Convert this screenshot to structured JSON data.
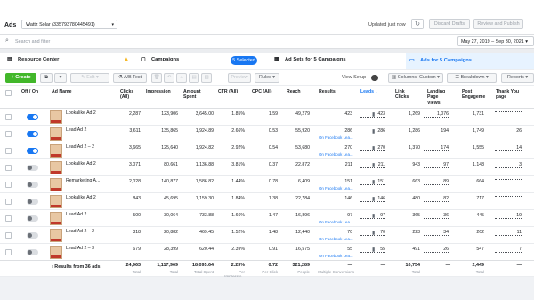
{
  "header": {
    "app": "Ads",
    "account": "Wattz Solar (335793780445491)",
    "updated": "Updated just now",
    "discard": "Discard Drafts",
    "review": "Review and Publish"
  },
  "search": {
    "placeholder": "Search and filter",
    "date_range": "May 27, 2019 – Sep 30, 2021"
  },
  "nav": {
    "resource_center": "Resource Center",
    "campaigns": "Campaigns",
    "selected": "5 Selected",
    "adsets": "Ad Sets for 5 Campaigns",
    "ads": "Ads for 5 Campaigns"
  },
  "toolbar": {
    "create": "+ Create",
    "edit": "Edit",
    "ab_test": "A/B Test",
    "preview": "Preview",
    "rules": "Rules",
    "view_setup": "View Setup",
    "columns": "Columns: Custom",
    "breakdown": "Breakdown",
    "reports": "Reports"
  },
  "columns": {
    "onoff": "Off / On",
    "ad_name": "Ad Name",
    "clicks": "Clicks (All)",
    "impression": "Impression",
    "amount": "Amount Spent",
    "ctr": "CTR (All)",
    "cpc": "CPC (All)",
    "reach": "Reach",
    "results": "Results",
    "leads": "Leads",
    "link_clicks": "Link Clicks",
    "landing": "Landing Page Views",
    "post_eng": "Post Engageme",
    "thankyou": "Thank You page"
  },
  "rows": [
    {
      "name": "Lookalike Ad 2",
      "on": true,
      "clicks": "2,287",
      "imp": "123,906",
      "amt": "3,645.00",
      "ctr": "1.85%",
      "cpc": "1.59",
      "reach": "49,279",
      "res": "423",
      "sub": "",
      "leads": "423",
      "link": "1,269",
      "lpv": "1,076",
      "post": "1,731",
      "ty": ""
    },
    {
      "name": "Lead Ad 2",
      "on": true,
      "clicks": "3,611",
      "imp": "135,865",
      "amt": "1,924.89",
      "ctr": "2.66%",
      "cpc": "0.53",
      "reach": "55,920",
      "res": "286",
      "sub": "On Facebook Lea...",
      "leads": "286",
      "link": "1,286",
      "lpv": "194",
      "post": "1,749",
      "ty": "26"
    },
    {
      "name": "Lead Ad 2 – 2",
      "on": true,
      "clicks": "3,665",
      "imp": "125,640",
      "amt": "1,924.82",
      "ctr": "2.92%",
      "cpc": "0.54",
      "reach": "53,680",
      "res": "270",
      "sub": "On Facebook Lea...",
      "leads": "270",
      "link": "1,370",
      "lpv": "174",
      "post": "1,555",
      "ty": "14"
    },
    {
      "name": "Lookalike Ad 2",
      "on": false,
      "clicks": "3,071",
      "imp": "80,661",
      "amt": "1,136.88",
      "ctr": "3.81%",
      "cpc": "0.37",
      "reach": "22,872",
      "res": "211",
      "sub": "",
      "leads": "211",
      "link": "943",
      "post": "1,148",
      "lpv": "97",
      "ty": "3"
    },
    {
      "name": "Remarketing A...",
      "on": false,
      "clicks": "2,028",
      "imp": "140,877",
      "amt": "1,586.82",
      "ctr": "1.44%",
      "cpc": "0.78",
      "reach": "6,409",
      "res": "151",
      "sub": "On Facebook Lea...",
      "leads": "151",
      "link": "663",
      "lpv": "89",
      "post": "664",
      "ty": ""
    },
    {
      "name": "Lookalike Ad 2",
      "on": false,
      "clicks": "843",
      "imp": "45,695",
      "amt": "1,159.30",
      "ctr": "1.84%",
      "cpc": "1.38",
      "reach": "22,784",
      "res": "146",
      "sub": "",
      "leads": "146",
      "link": "480",
      "lpv": "82",
      "post": "717",
      "ty": ""
    },
    {
      "name": "Lead Ad 2",
      "on": false,
      "clicks": "500",
      "imp": "30,064",
      "amt": "733.88",
      "ctr": "1.66%",
      "cpc": "1.47",
      "reach": "16,896",
      "res": "97",
      "sub": "On Facebook Lea...",
      "leads": "97",
      "link": "365",
      "lpv": "36",
      "post": "445",
      "ty": "19"
    },
    {
      "name": "Lead Ad 2 – 2",
      "on": false,
      "clicks": "318",
      "imp": "20,882",
      "amt": "469.45",
      "ctr": "1.52%",
      "cpc": "1.48",
      "reach": "12,440",
      "res": "70",
      "sub": "On Facebook Lea...",
      "leads": "70",
      "link": "223",
      "lpv": "34",
      "post": "262",
      "ty": "11"
    },
    {
      "name": "Lead Ad 2 – 3",
      "on": false,
      "clicks": "679",
      "imp": "28,399",
      "amt": "620.44",
      "ctr": "2.39%",
      "cpc": "0.91",
      "reach": "16,575",
      "res": "55",
      "sub": "On Facebook Lea...",
      "leads": "55",
      "link": "491",
      "lpv": "26",
      "post": "547",
      "ty": "7"
    }
  ],
  "totals": {
    "label": "Results from 36 ads",
    "clicks": "24,963",
    "imp": "1,117,969",
    "amt": "18,095.64",
    "ctr": "2.23%",
    "cpc": "0.72",
    "reach": "321,289",
    "res": "—",
    "leads": "—",
    "link": "10,754",
    "lpv": "—",
    "post": "2,449",
    "ty": "—",
    "l_clicks": "Total",
    "l_imp": "Total",
    "l_amt": "Total Spent",
    "l_ctr": "Per Impressio...",
    "l_cpc": "Per Click",
    "l_reach": "People",
    "l_res": "Multiple Conversions",
    "l_link": "Total",
    "l_post": "Total"
  }
}
